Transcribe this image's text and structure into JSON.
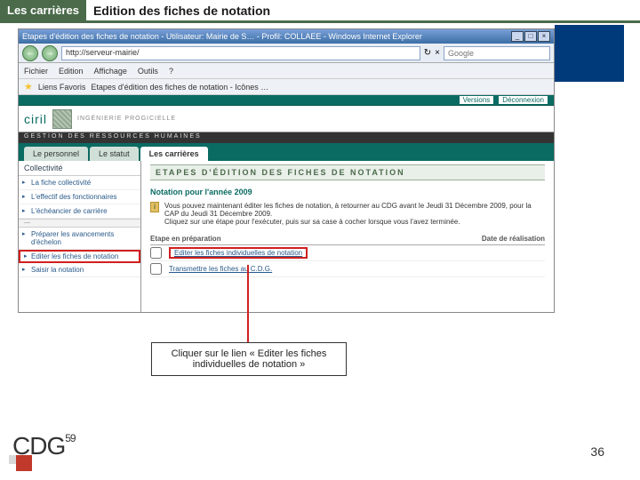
{
  "slide": {
    "section": "Les carrières",
    "title": "Edition des fiches de notation",
    "page": "36",
    "logo": "CDG",
    "logo_sup": "59"
  },
  "ie": {
    "title": "Etapes d'édition des fiches de notation - Utilisateur: Mairie de S… - Profil: COLLAEE - Windows Internet Explorer",
    "min": "_",
    "max": "□",
    "close": "×",
    "back": "←",
    "fwd": "→",
    "url": "http://serveur-mairie/",
    "refresh": "↻",
    "stop": "×",
    "search_placeholder": "Google",
    "menu": {
      "file": "Fichier",
      "edit": "Edition",
      "view": "Affichage",
      "tools": "Outils",
      "help": "?"
    },
    "fav_label": "Liens Favoris",
    "fav_page": "Etapes d'édition des fiches de notation - Icônes …",
    "link_versions": "Versions",
    "link_logout": "Déconnexion"
  },
  "brand": {
    "name": "ciril",
    "tagline": "INGÉNIERIE PROGICIELLE",
    "sub": "GESTION DES RESSOURCES HUMAINES"
  },
  "tabs": {
    "t1": "Le personnel",
    "t2": "Le statut",
    "t3": "Les carrières"
  },
  "sidebar": {
    "h1": "Collectivité",
    "i1": "La fiche collectivité",
    "i2": "L'effectif des fonctionnaires",
    "i3": "L'échéancier de carrière",
    "sep": "—",
    "i4": "Préparer les avancements d'échelon",
    "i5": "Editer les fiches de notation",
    "i6": "Saisir la notation"
  },
  "main": {
    "heading": "ETAPES D'ÉDITION DES FICHES DE NOTATION",
    "sub": "Notation pour l'année 2009",
    "info1": "Vous pouvez maintenant éditer les fiches de notation, à retourner au CDG avant le Jeudi 31 Décembre 2009, pour la CAP du Jeudi 31 Décembre 2009.",
    "info2": "Cliquez sur une étape pour l'exécuter, puis sur sa case à cocher lorsque vous l'avez terminée.",
    "col1": "Etape en préparation",
    "col2": "Date de réalisation",
    "s1": "Editer les fiches individuelles de notation",
    "s2": "Transmettre les fiches au C.D.G."
  },
  "callout": "Cliquer sur le lien « Editer les fiches individuelles de notation »"
}
